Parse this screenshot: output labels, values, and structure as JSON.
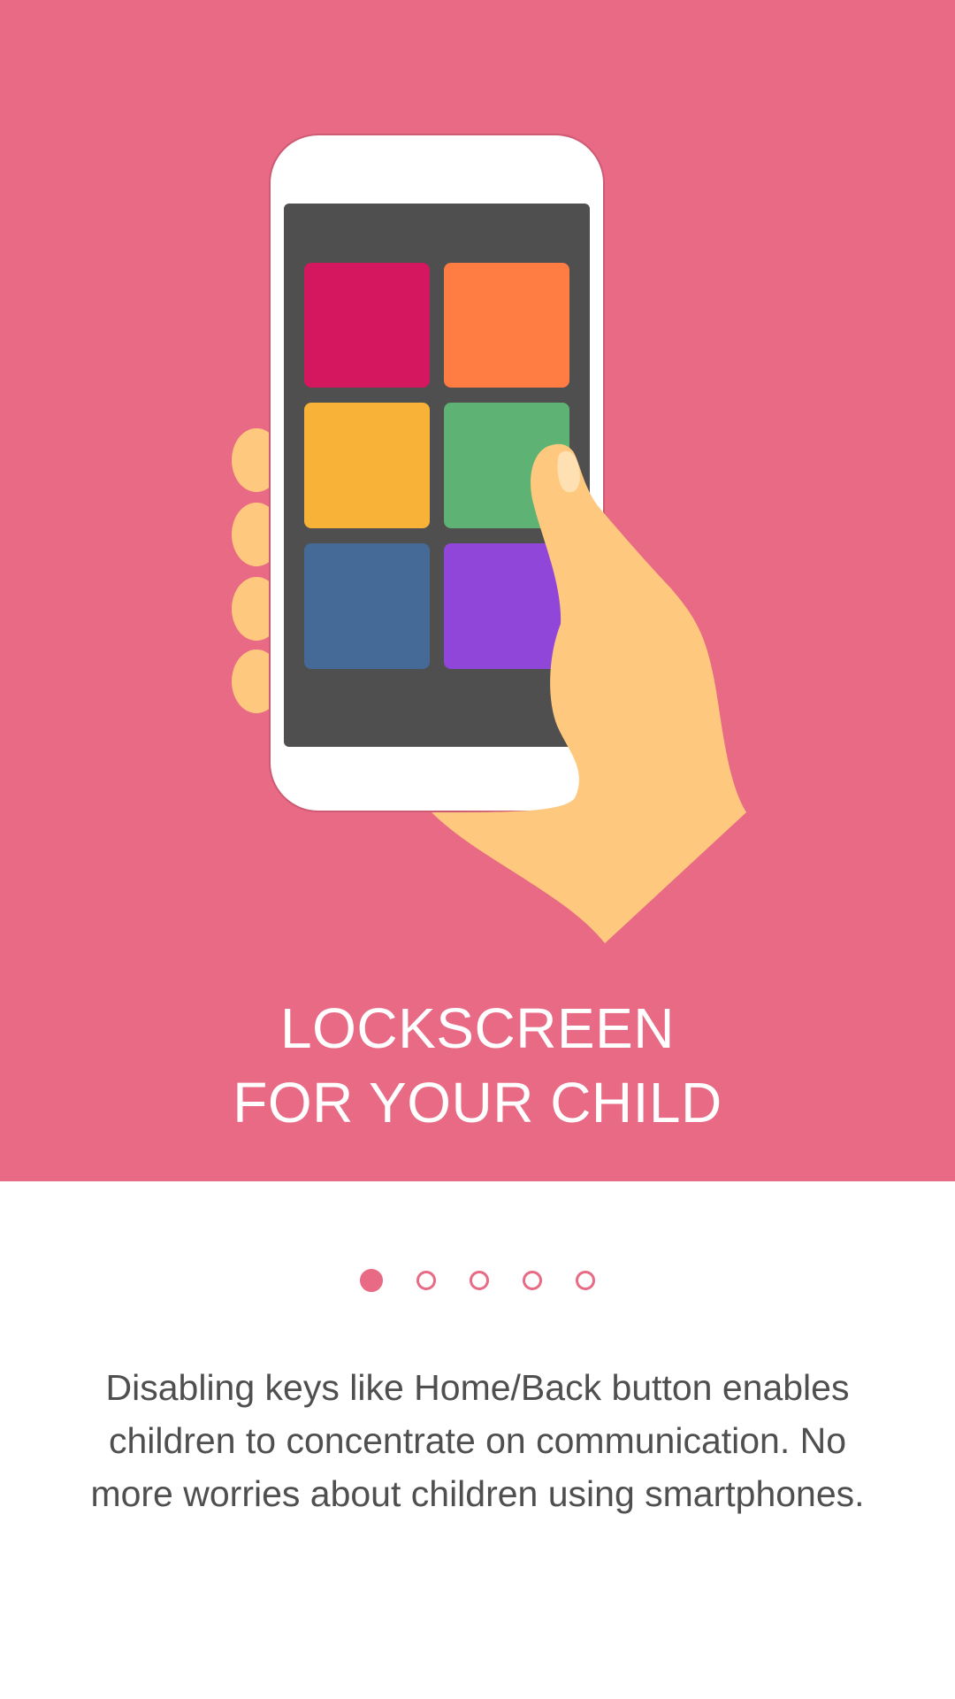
{
  "onboarding": {
    "title_line1": "LOCKSCREEN",
    "title_line2": "FOR YOUR CHILD",
    "description": "Disabling keys like Home/Back button enables children to concentrate on communication. No more worries about children using smartphones.",
    "page_count": 5,
    "current_page": 1
  },
  "colors": {
    "background": "#e86a84",
    "phone_body": "#ffffff",
    "phone_screen": "#4f4f4f",
    "hand": "#fec97f",
    "tiles": [
      "#d4175f",
      "#ff7c43",
      "#f9b238",
      "#5eb274",
      "#466a97",
      "#9046d8"
    ]
  },
  "icons": {
    "illustration": "hand-holding-phone-illustration"
  }
}
